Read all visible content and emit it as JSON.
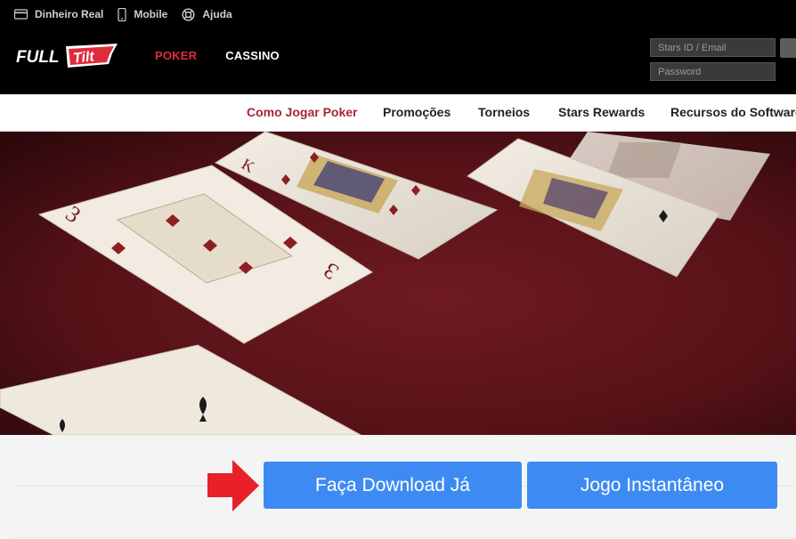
{
  "utility_bar": [
    {
      "label": "Dinheiro Real",
      "icon": "credit-card-icon"
    },
    {
      "label": "Mobile",
      "icon": "mobile-phone-icon"
    },
    {
      "label": "Ajuda",
      "icon": "lifebuoy-icon"
    }
  ],
  "logo": {
    "text_full": "FULL",
    "text_tilt": "Tilt"
  },
  "main_nav": [
    {
      "label": "POKER",
      "active": true
    },
    {
      "label": "CASSINO",
      "active": false
    }
  ],
  "login": {
    "username_placeholder": "Stars ID / Email",
    "password_placeholder": "Password"
  },
  "sub_nav": [
    {
      "label": "Como Jogar Poker",
      "active": true
    },
    {
      "label": "Promoções",
      "active": false
    },
    {
      "label": "Torneios",
      "active": false
    },
    {
      "label": "Stars Rewards",
      "active": false
    },
    {
      "label": "Recursos do Software",
      "active": false
    }
  ],
  "hero": {
    "card_rank_large": "3",
    "card_rank_king": "K"
  },
  "cta": {
    "download_label": "Faça Download Já",
    "instant_label": "Jogo Instantâneo"
  },
  "colors": {
    "header_bg": "#000000",
    "accent_red": "#e02b3c",
    "subnav_active": "#a72637",
    "button_blue": "#3d8bf2",
    "felt": "#5a1217",
    "arrow_red": "#e8202a"
  }
}
